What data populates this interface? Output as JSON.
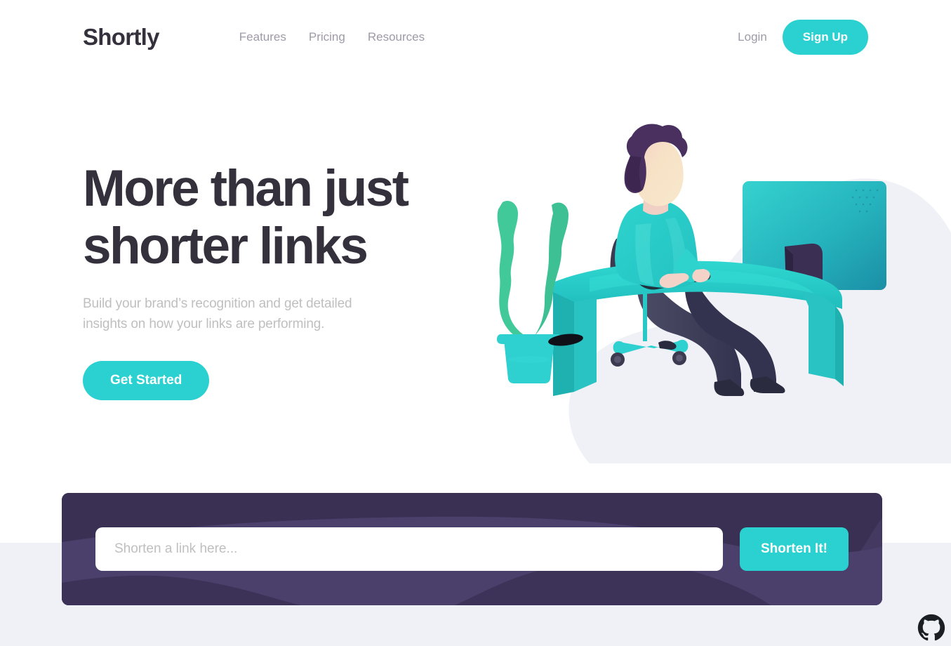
{
  "brand": {
    "name": "Shortly",
    "logo_color": "#34313d"
  },
  "nav": {
    "links": [
      {
        "label": "Features"
      },
      {
        "label": "Pricing"
      },
      {
        "label": "Resources"
      }
    ],
    "login_label": "Login",
    "signup_label": "Sign Up"
  },
  "hero": {
    "title": "More than just\nshorter links",
    "subtitle": "Build your brand’s recognition and get detailed\ninsights on how your links are performing.",
    "cta_label": "Get Started",
    "illustration_name": "person-working-at-desk-illustration"
  },
  "shorten": {
    "placeholder": "Shorten a link here...",
    "input_value": "",
    "button_label": "Shorten It!"
  },
  "footer": {
    "github_icon": "github-icon"
  },
  "colors": {
    "accent_cyan": "#2bd0d0",
    "dark_violet": "#3a3054",
    "card_wave": "#4b3f6b",
    "text_dark": "#34313d",
    "text_gray": "#9e9aa7",
    "text_light_gray": "#bfbfbf",
    "band_gray": "#eff1f6",
    "blob_gray": "#eff1f6",
    "hair_purple": "#49305f",
    "skin": "#f6dfc4",
    "skin_shadow": "#f0cfc4",
    "leg_navy": "#33334f",
    "plant_green": "#41c99a",
    "desk_teal": "#28cfcf",
    "monitor_dark_teal": "#1f9aa8"
  }
}
